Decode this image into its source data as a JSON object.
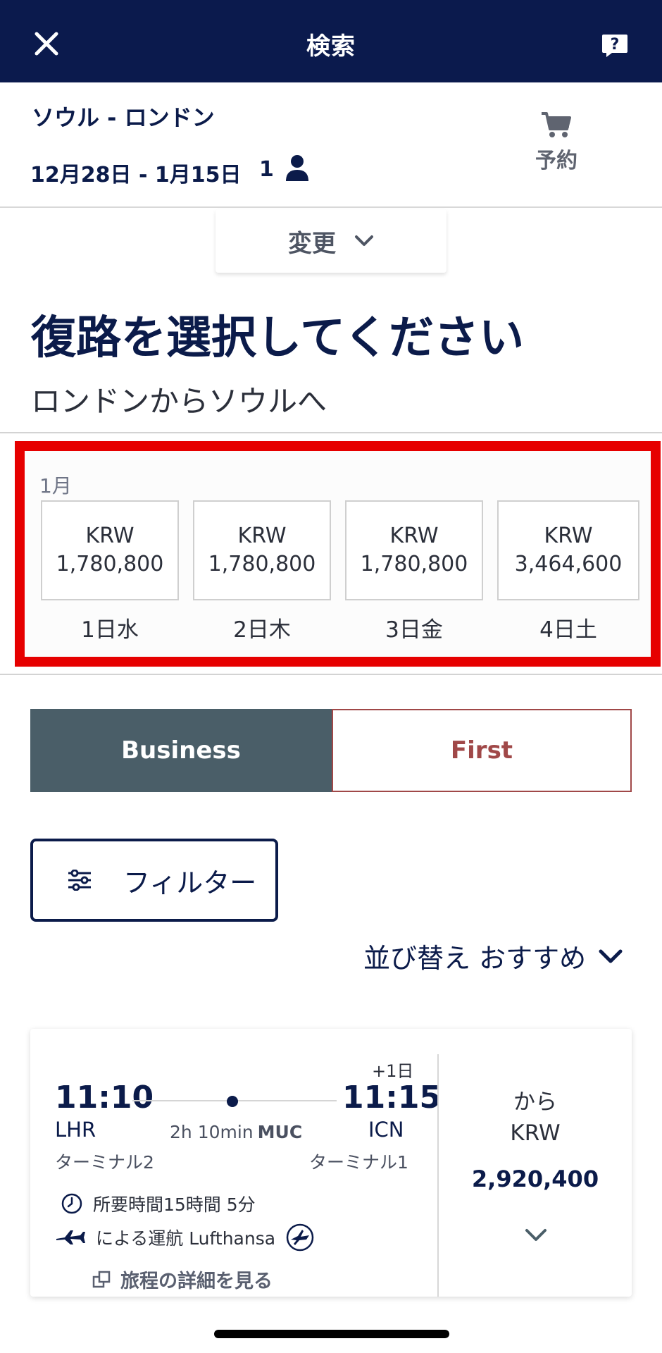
{
  "header": {
    "title": "検索"
  },
  "summary": {
    "route": "ソウル - ロンドン",
    "dates": "12月28日 - 1月15日",
    "passengers": "1",
    "cart_label": "予約"
  },
  "change_button": {
    "label": "変更"
  },
  "page": {
    "heading": "復路を選択してください",
    "subheading": "ロンドンからソウルへ"
  },
  "date_selector": {
    "month": "1月",
    "dates": [
      {
        "currency": "KRW",
        "price": "1,780,800",
        "label": "1日水"
      },
      {
        "currency": "KRW",
        "price": "1,780,800",
        "label": "2日木"
      },
      {
        "currency": "KRW",
        "price": "1,780,800",
        "label": "3日金"
      },
      {
        "currency": "KRW",
        "price": "3,464,600",
        "label": "4日土"
      }
    ]
  },
  "cabin_tabs": {
    "business": "Business",
    "first": "First",
    "selected": "Business"
  },
  "filter": {
    "label": "フィルター"
  },
  "sort": {
    "label": "並び替え おすすめ"
  },
  "flight": {
    "departure_time": "11:10",
    "arrival_time": "11:15",
    "day_offset": "+1日",
    "departure_airport": "LHR",
    "arrival_airport": "ICN",
    "layover_duration": "2h 10min",
    "layover_airport": "MUC",
    "departure_terminal": "ターミナル2",
    "arrival_terminal": "ターミナル1",
    "total_duration": "所要時間15時間 5分",
    "operated_by": "による運航 Lufthansa",
    "details_link": "旅程の詳細を見る",
    "price_prefix": "から",
    "price_currency": "KRW",
    "price_amount": "2,920,400"
  },
  "colors": {
    "header_bg": "#0b1a4d",
    "highlight_border": "#e60000",
    "business_bg": "#4a5e68",
    "first_accent": "#a04848"
  },
  "icons": [
    "close-icon",
    "help-icon",
    "user-icon",
    "cart-icon",
    "chevron-down-icon",
    "sliders-icon",
    "clock-icon",
    "plane-icon",
    "lufthansa-logo",
    "external-link-icon"
  ]
}
